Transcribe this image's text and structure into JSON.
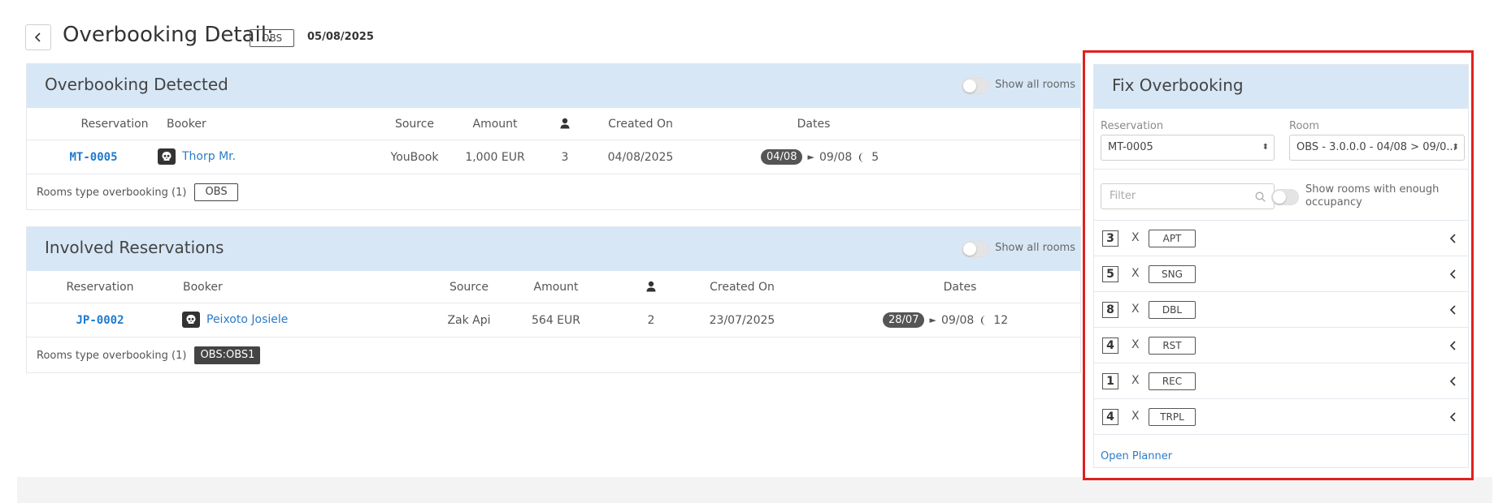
{
  "header": {
    "title": "Overbooking Detail:",
    "badge": "OBS",
    "date": "05/08/2025"
  },
  "detected": {
    "title": "Overbooking Detected",
    "toggle_label": "Show all rooms",
    "columns": [
      "Reservation",
      "Booker",
      "Source",
      "Amount",
      "guests-icon",
      "Created On",
      "Dates"
    ],
    "row": {
      "reservation": "MT-0005",
      "booker": "Thorp Mr.",
      "source": "YouBook",
      "amount": "1,000 EUR",
      "guests": "3",
      "created_on": "04/08/2025",
      "date_from": "04/08",
      "date_to": "09/08",
      "nights": "5"
    },
    "footer_label": "Rooms type overbooking (1)",
    "footer_badge": "OBS"
  },
  "involved": {
    "title": "Involved Reservations",
    "toggle_label": "Show all rooms",
    "columns": [
      "Reservation",
      "Booker",
      "Source",
      "Amount",
      "guests-icon",
      "Created On",
      "Dates"
    ],
    "row": {
      "reservation": "JP-0002",
      "booker": "Peixoto Josiele",
      "source": "Zak Api",
      "amount": "564 EUR",
      "guests": "2",
      "created_on": "23/07/2025",
      "date_from": "28/07",
      "date_to": "09/08",
      "nights": "12"
    },
    "footer_label": "Rooms type overbooking (1)",
    "footer_badge": "OBS:OBS1"
  },
  "fix": {
    "title": "Fix Overbooking",
    "reservation_label": "Reservation",
    "reservation_value": "MT-0005",
    "room_label": "Room",
    "room_value": "OBS - 3.0.0.0 - 04/08 > 09/0...",
    "filter_placeholder": "Filter",
    "occupancy_toggle_label": "Show rooms with enough occupancy",
    "rooms": [
      {
        "count": "3",
        "x": "X",
        "type": "APT"
      },
      {
        "count": "5",
        "x": "X",
        "type": "SNG"
      },
      {
        "count": "8",
        "x": "X",
        "type": "DBL"
      },
      {
        "count": "4",
        "x": "X",
        "type": "RST"
      },
      {
        "count": "1",
        "x": "X",
        "type": "REC"
      },
      {
        "count": "4",
        "x": "X",
        "type": "TRPL"
      }
    ],
    "open_planner": "Open Planner"
  },
  "colors": {
    "panel_header_bg": "#d7e7f6",
    "link": "#2a7cc7",
    "highlight_border": "#e02020"
  }
}
